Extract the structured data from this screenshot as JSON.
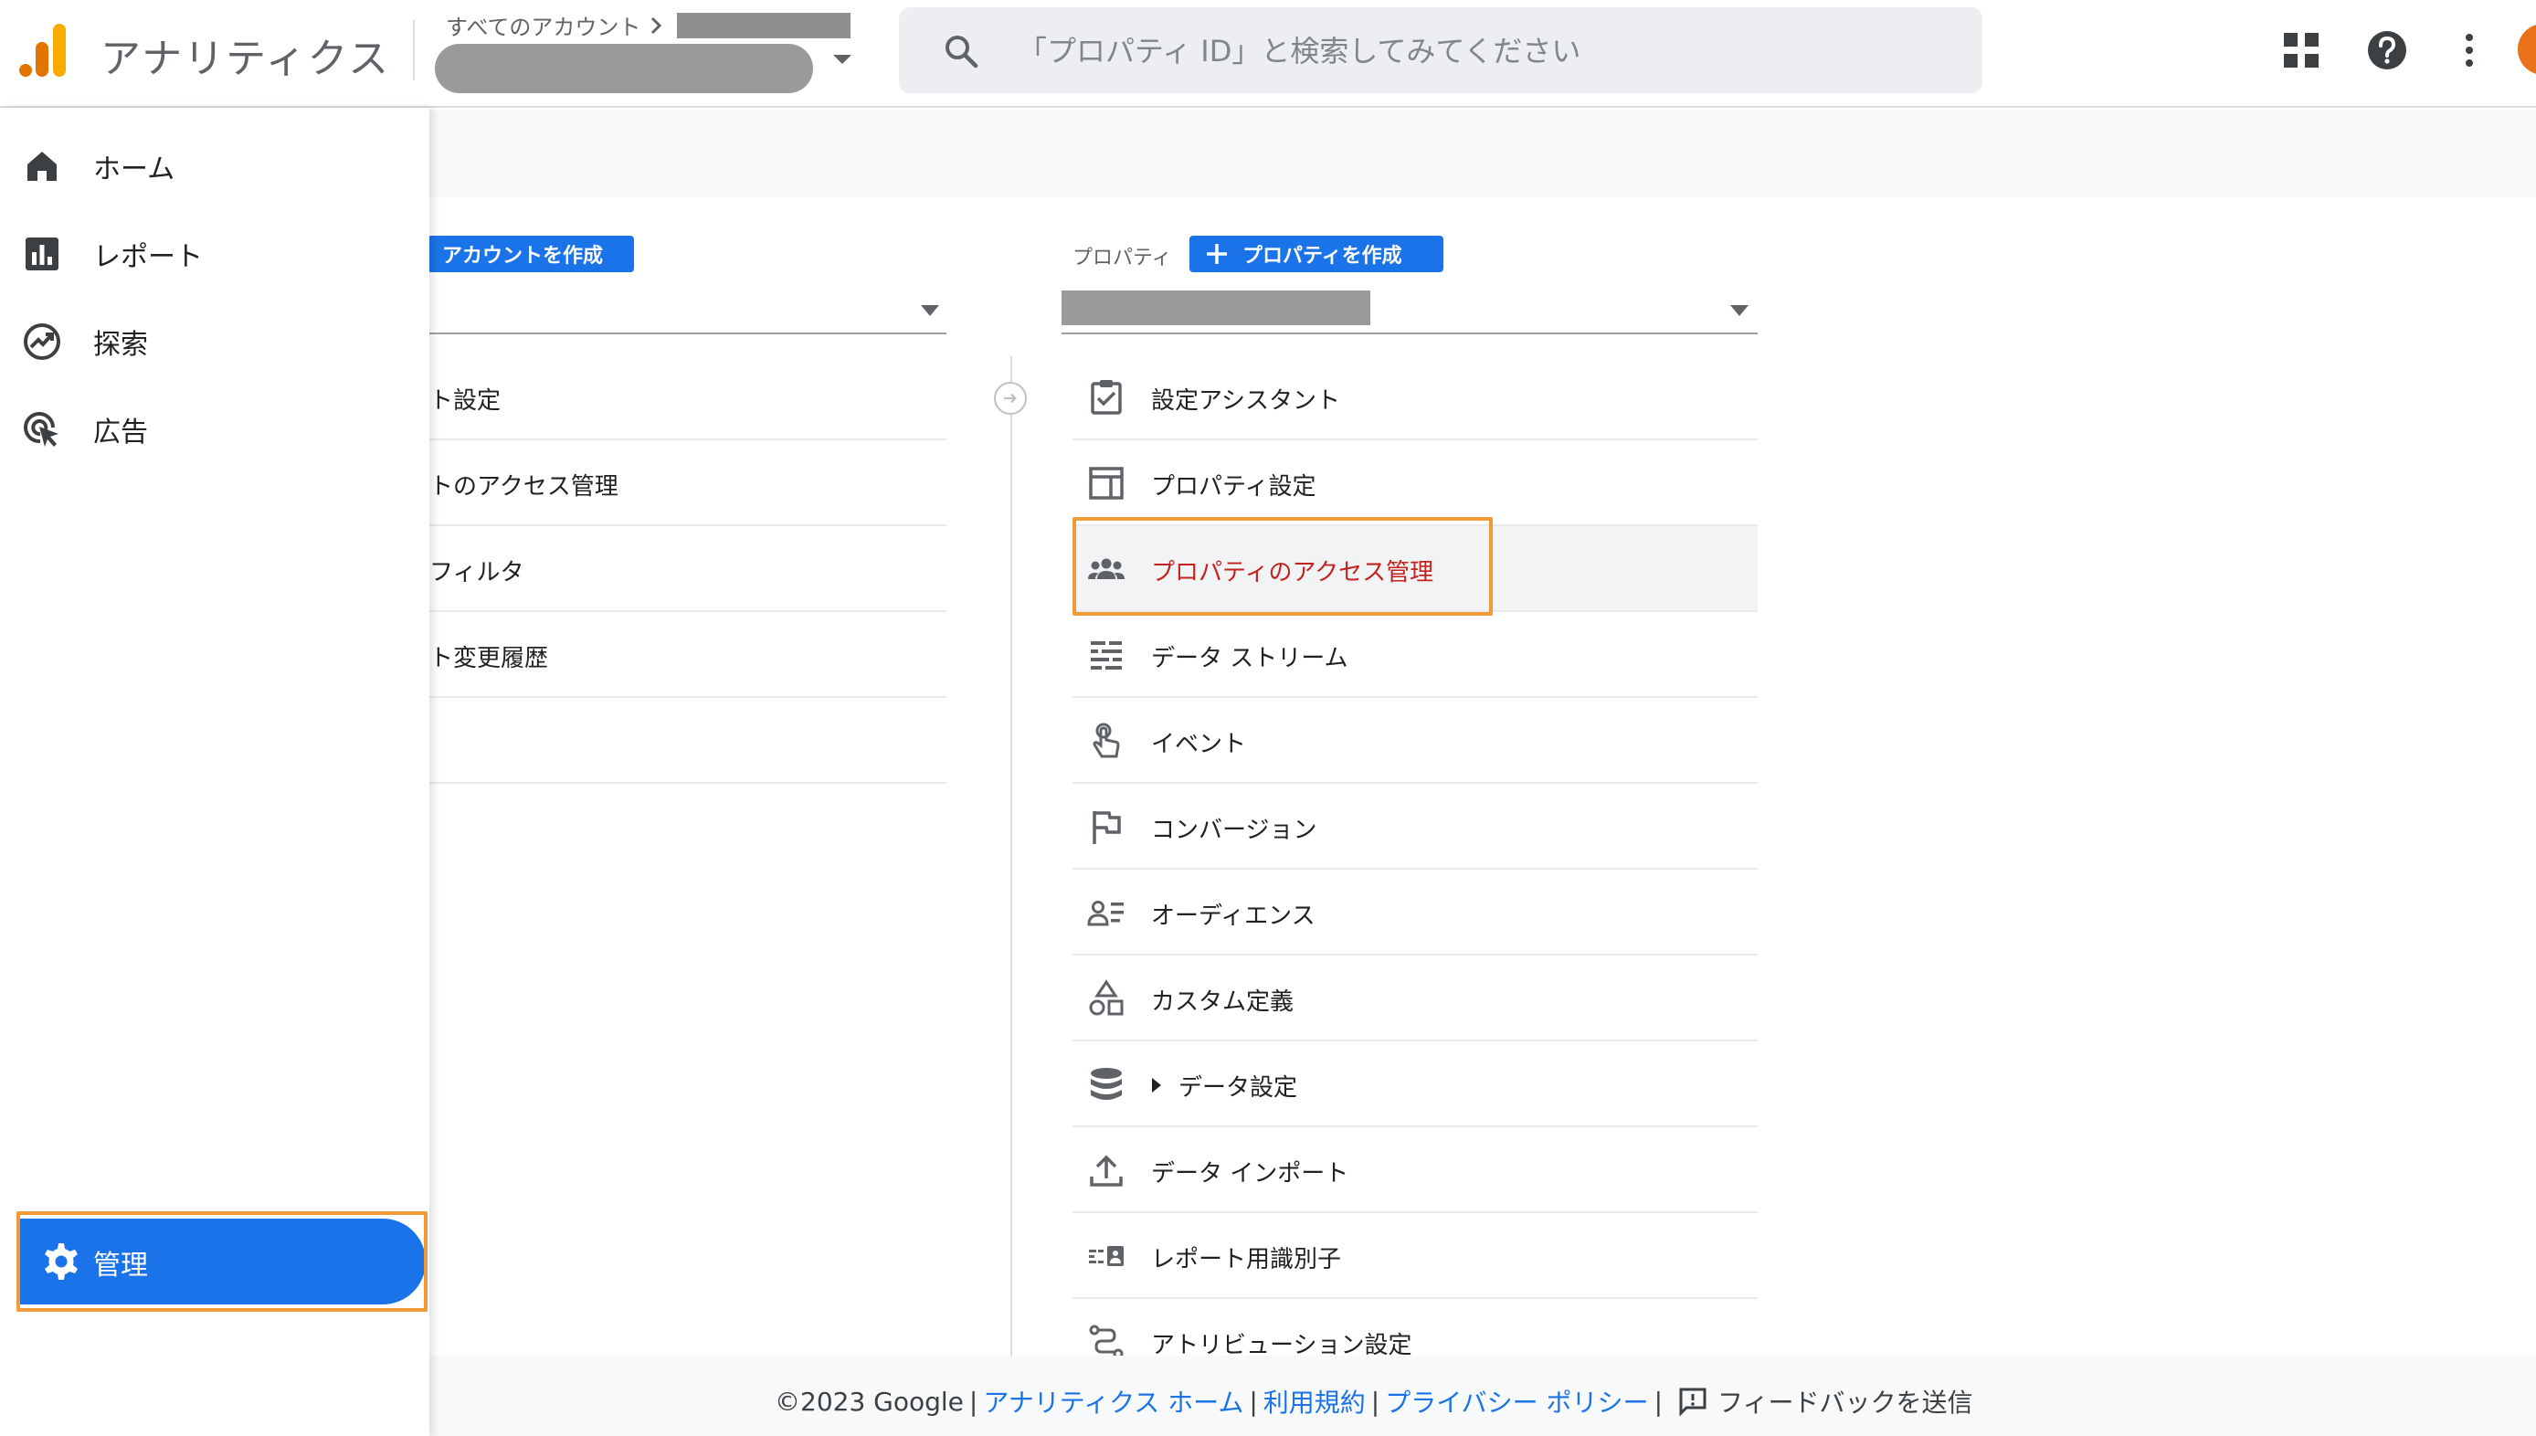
{
  "header": {
    "app_title": "アナリティクス",
    "breadcrumb_all_accounts": "すべてのアカウント",
    "search_placeholder": "「プロパティ ID」と検索してみてください"
  },
  "sidenav": {
    "items": [
      {
        "label": "ホーム",
        "icon": "home-icon"
      },
      {
        "label": "レポート",
        "icon": "bar-chart-icon"
      },
      {
        "label": "探索",
        "icon": "explore-icon"
      },
      {
        "label": "広告",
        "icon": "ads-cursor-icon"
      }
    ],
    "admin_label": "管理"
  },
  "account_column": {
    "create_button": "アカウントを作成",
    "items": [
      "ト設定",
      "トのアクセス管理",
      "フィルタ",
      "ト変更履歴"
    ]
  },
  "property_column": {
    "label": "プロパティ",
    "create_button": "プロパティを作成",
    "items": [
      {
        "label": "設定アシスタント",
        "icon": "clipboard-check-icon"
      },
      {
        "label": "プロパティ設定",
        "icon": "layout-icon"
      },
      {
        "label": "プロパティのアクセス管理",
        "icon": "people-icon",
        "active": true
      },
      {
        "label": "データ ストリーム",
        "icon": "data-stream-icon"
      },
      {
        "label": "イベント",
        "icon": "touch-icon"
      },
      {
        "label": "コンバージョン",
        "icon": "flag-icon"
      },
      {
        "label": "オーディエンス",
        "icon": "audience-icon"
      },
      {
        "label": "カスタム定義",
        "icon": "shapes-icon"
      },
      {
        "label": "データ設定",
        "icon": "database-icon"
      },
      {
        "label": "データ インポート",
        "icon": "upload-icon"
      },
      {
        "label": "レポート用識別子",
        "icon": "identifier-icon"
      },
      {
        "label": "アトリビューション設定",
        "icon": "attribution-icon"
      }
    ]
  },
  "footer": {
    "copyright": "©2023 Google",
    "link_home": "アナリティクス ホーム",
    "link_terms": "利用規約",
    "link_privacy": "プライバシー ポリシー",
    "feedback": "フィードバックを送信",
    "separator": "|"
  },
  "colors": {
    "accent": "#1a73e8",
    "highlight_outline": "#f29a37",
    "active_text": "#c5221f"
  }
}
